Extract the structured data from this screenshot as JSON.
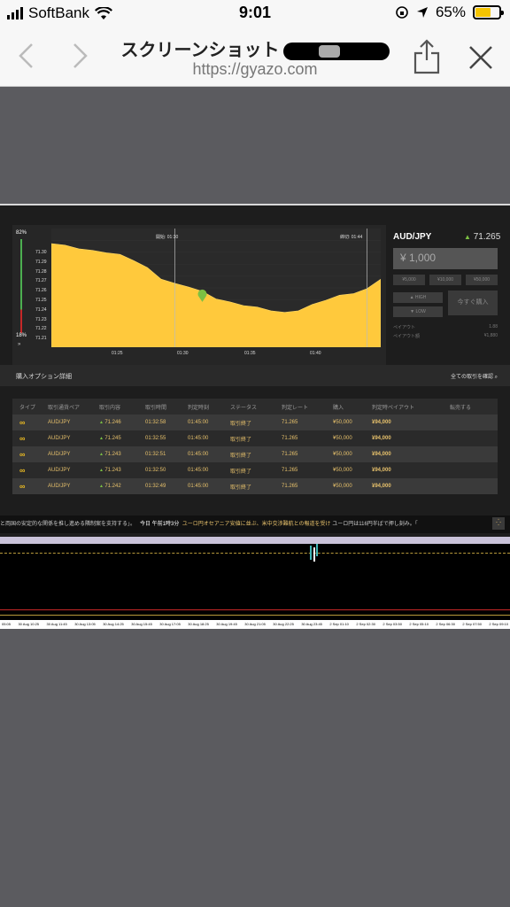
{
  "status": {
    "carrier": "SoftBank",
    "time": "9:01",
    "battery": "65%"
  },
  "browser": {
    "title": "スクリーンショット",
    "url": "https://gyazo.com"
  },
  "chart": {
    "pct_top": "82%",
    "pct_bottom": "18%",
    "start_label": "開始: 01:30",
    "end_label": "締切: 01:44",
    "y_ticks": [
      "71.30",
      "71.29",
      "71.28",
      "71.27",
      "71.26",
      "71.25",
      "71.24",
      "71.23",
      "71.22",
      "71.21"
    ],
    "x_ticks": [
      "01:25",
      "01:30",
      "01:35",
      "01:40"
    ]
  },
  "chart_data": {
    "type": "area",
    "x": [
      "01:21",
      "01:22",
      "01:23",
      "01:24",
      "01:25",
      "01:26",
      "01:27",
      "01:28",
      "01:29",
      "01:30",
      "01:31",
      "01:32",
      "01:33",
      "01:34",
      "01:35",
      "01:36",
      "01:37",
      "01:38",
      "01:39",
      "01:40",
      "01:41",
      "01:42",
      "01:43",
      "01:44",
      "01:45"
    ],
    "series": [
      {
        "values": [
          71.289,
          71.287,
          71.285,
          71.283,
          71.282,
          71.28,
          71.276,
          71.27,
          71.262,
          71.258,
          71.256,
          71.252,
          71.247,
          71.244,
          71.242,
          71.24,
          71.238,
          71.236,
          71.238,
          71.242,
          71.246,
          71.249,
          71.251,
          71.254,
          71.262
        ]
      }
    ],
    "ylim": [
      71.21,
      71.3
    ],
    "marker": {
      "x": "01:32",
      "y": 71.247
    }
  },
  "panel": {
    "pair": "AUD/JPY",
    "rate": "71.265",
    "amount": "¥ 1,000",
    "quick": [
      "¥5,000",
      "¥10,000",
      "¥50,000"
    ],
    "high": "HIGH",
    "low": "LOW",
    "buy_now": "今すぐ購入",
    "payout_label": "ペイアウト",
    "payout_value": "1.88",
    "payout_amount_label": "ペイアウト額",
    "payout_amount_value": "¥1,880"
  },
  "detail": {
    "title": "購入オプション詳細",
    "link": "全ての取引を確認",
    "headers": [
      "タイプ",
      "取引通貨ペア",
      "取引内容",
      "取引時間",
      "判定時刻",
      "ステータス",
      "判定レート",
      "購入",
      "判定時ペイアウト",
      "転売する"
    ],
    "rows": [
      {
        "pair": "AUD/JPY",
        "rate": "71.246",
        "time": "01:32:58",
        "judge": "01:45:00",
        "status": "取引終了",
        "judge_rate": "71.265",
        "buy": "¥50,000",
        "payout": "¥94,000"
      },
      {
        "pair": "AUD/JPY",
        "rate": "71.245",
        "time": "01:32:55",
        "judge": "01:45:00",
        "status": "取引終了",
        "judge_rate": "71.265",
        "buy": "¥50,000",
        "payout": "¥94,000"
      },
      {
        "pair": "AUD/JPY",
        "rate": "71.243",
        "time": "01:32:51",
        "judge": "01:45:00",
        "status": "取引終了",
        "judge_rate": "71.265",
        "buy": "¥50,000",
        "payout": "¥94,000"
      },
      {
        "pair": "AUD/JPY",
        "rate": "71.243",
        "time": "01:32:50",
        "judge": "01:45:00",
        "status": "取引終了",
        "judge_rate": "71.265",
        "buy": "¥50,000",
        "payout": "¥94,000"
      },
      {
        "pair": "AUD/JPY",
        "rate": "71.242",
        "time": "01:32:49",
        "judge": "01:45:00",
        "status": "取引終了",
        "judge_rate": "71.265",
        "buy": "¥50,000",
        "payout": "¥94,000"
      }
    ]
  },
  "ticker": {
    "left": "と両国の安定的な関係を推し進める隣制案を支持する」。",
    "today": "今日 午前1時3分",
    "news1": "ユーロ円オセアニア安値に並ぶ、米中交渉難航との報道を受け",
    "news2": "ユーロ円は116円半ばで押し刻み。「"
  },
  "lower_axis": [
    "05:05",
    "30 Aug 10:25",
    "30 Aug 11:45",
    "30 Aug 13:05",
    "30 Aug 14:25",
    "30 Aug 15:45",
    "30 Aug 17:05",
    "30 Aug 18:25",
    "30 Aug 19:45",
    "30 Aug 21:05",
    "30 Aug 22:25",
    "30 Aug 23:45",
    "2 Sep 01:10",
    "2 Sep 02:30",
    "2 Sep 03:50",
    "2 Sep 05:10",
    "2 Sep 06:30",
    "2 Sep 07:50",
    "2 Sep 09:10"
  ]
}
